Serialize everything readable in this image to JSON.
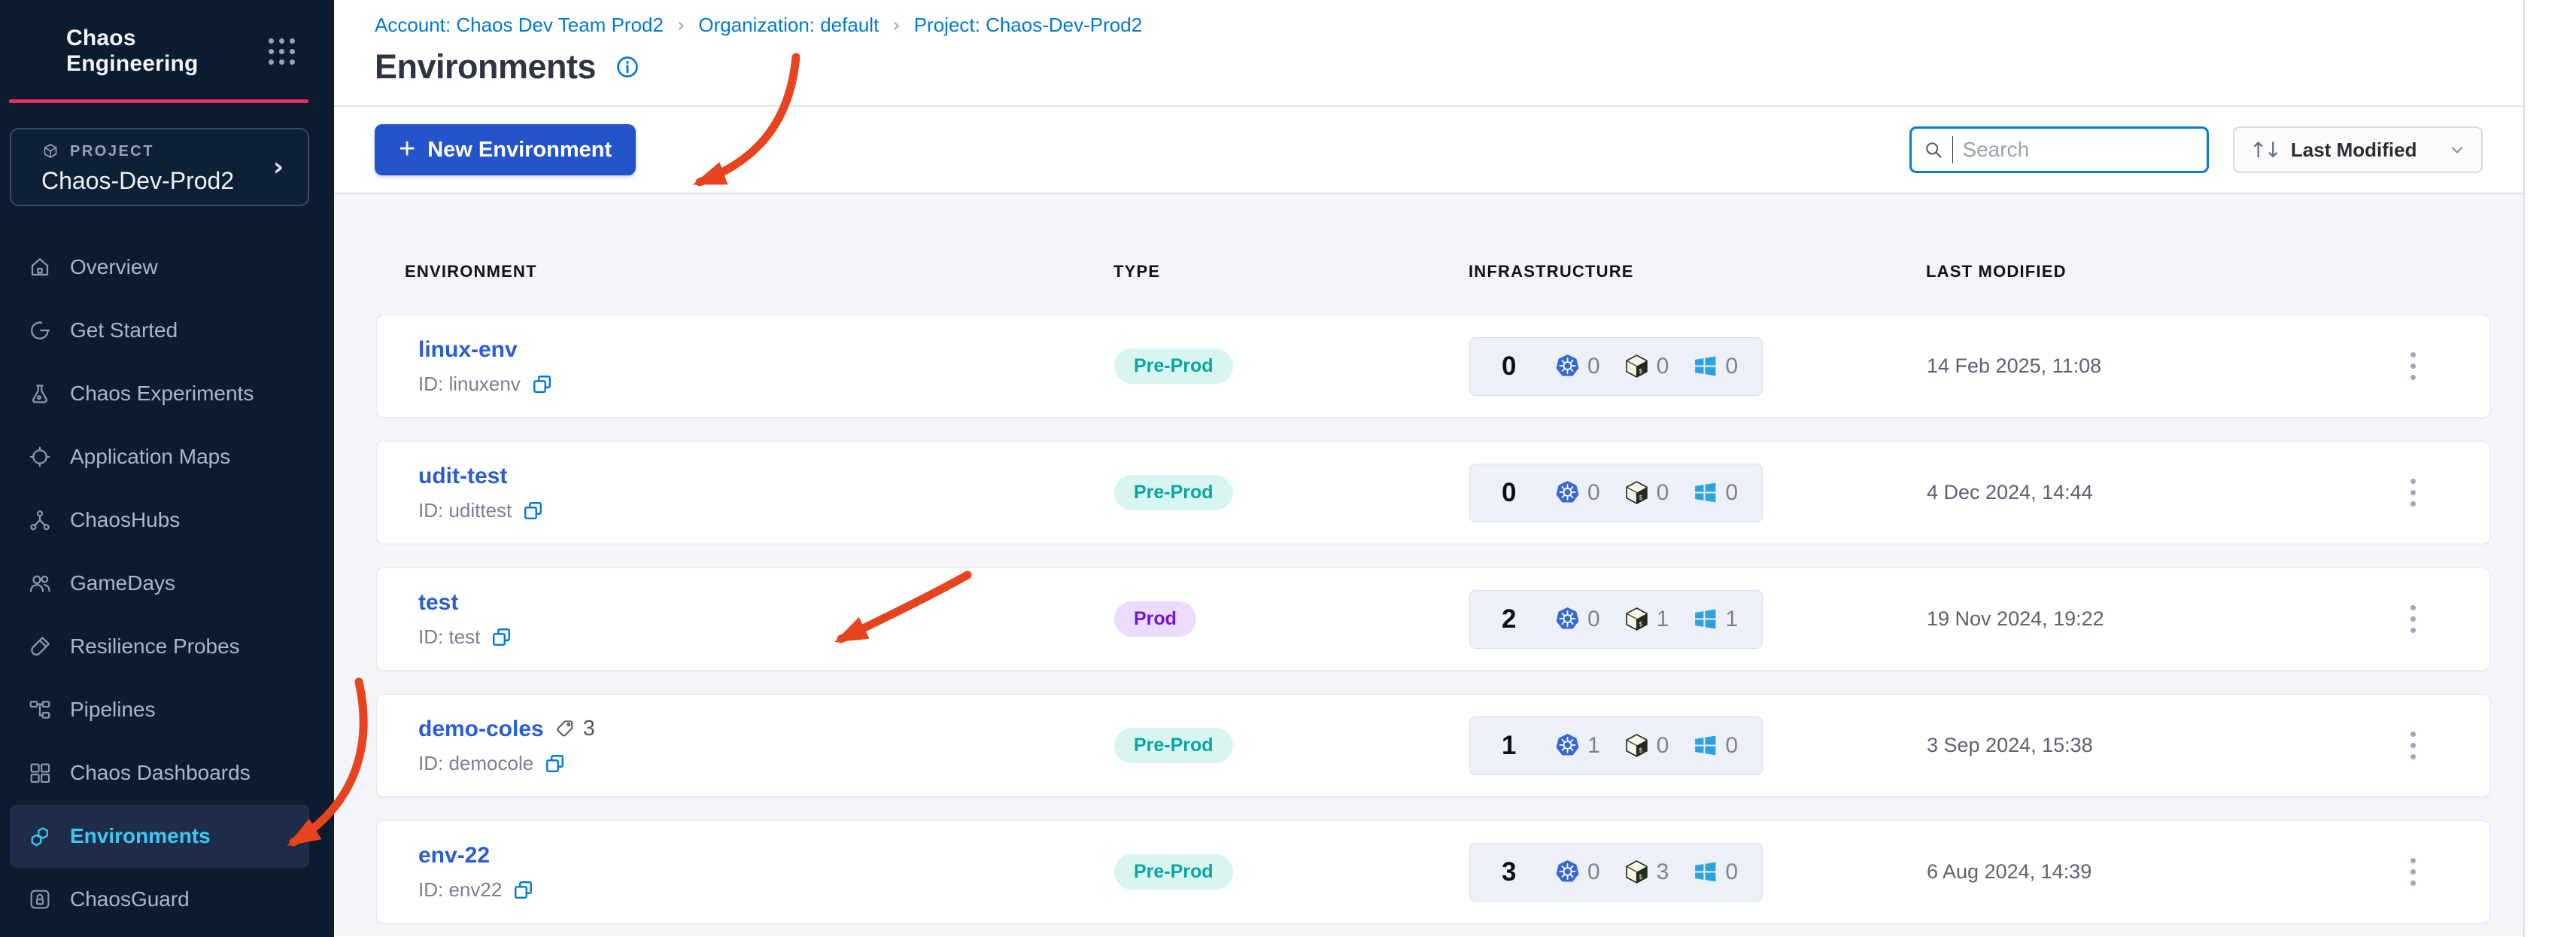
{
  "sidebar": {
    "brand": "Chaos Engineering",
    "project_label": "PROJECT",
    "project_name": "Chaos-Dev-Prod2",
    "project_chevron": "›",
    "items": [
      {
        "label": "Overview"
      },
      {
        "label": "Get Started"
      },
      {
        "label": "Chaos Experiments"
      },
      {
        "label": "Application Maps"
      },
      {
        "label": "ChaosHubs"
      },
      {
        "label": "GameDays"
      },
      {
        "label": "Resilience Probes"
      },
      {
        "label": "Pipelines"
      },
      {
        "label": "Chaos Dashboards"
      },
      {
        "label": "Environments"
      },
      {
        "label": "ChaosGuard"
      }
    ]
  },
  "breadcrumb": {
    "account": "Account: Chaos Dev Team Prod2",
    "org": "Organization: default",
    "project": "Project: Chaos-Dev-Prod2",
    "separator": "›"
  },
  "page": {
    "title": "Environments"
  },
  "toolbar": {
    "plus": "+",
    "new_button": "New Environment",
    "search_placeholder": "Search",
    "sort_arrows": "↑↓",
    "sort_label": "Last Modified"
  },
  "table": {
    "headers": [
      "ENVIRONMENT",
      "TYPE",
      "INFRASTRUCTURE",
      "LAST MODIFIED"
    ]
  },
  "rows": [
    {
      "name": "linux-env",
      "id": "ID: linuxenv",
      "type": "Pre-Prod",
      "type_variant": "preprod",
      "total": "0",
      "k8s": "0",
      "linux": "0",
      "windows": "0",
      "modified": "14 Feb 2025, 11:08"
    },
    {
      "name": "udit-test",
      "id": "ID: udittest",
      "type": "Pre-Prod",
      "type_variant": "preprod",
      "total": "0",
      "k8s": "0",
      "linux": "0",
      "windows": "0",
      "modified": "4 Dec 2024, 14:44"
    },
    {
      "name": "test",
      "id": "ID: test",
      "type": "Prod",
      "type_variant": "prod",
      "total": "2",
      "k8s": "0",
      "linux": "1",
      "windows": "1",
      "modified": "19 Nov 2024, 19:22"
    },
    {
      "name": "demo-coles",
      "id": "ID: democole",
      "tags": "3",
      "type": "Pre-Prod",
      "type_variant": "preprod",
      "total": "1",
      "k8s": "1",
      "linux": "0",
      "windows": "0",
      "modified": "3 Sep 2024, 15:38"
    },
    {
      "name": "env-22",
      "id": "ID: env22",
      "type": "Pre-Prod",
      "type_variant": "preprod",
      "total": "3",
      "k8s": "0",
      "linux": "3",
      "windows": "0",
      "modified": "6 Aug 2024, 14:39"
    }
  ],
  "colors": {
    "sidebar_bg": "#0b1b30",
    "accent_pink": "#ef2b61",
    "active_cyan": "#3cc8f4",
    "primary_button": "#2454c9",
    "link_blue": "#0278d5",
    "name_blue": "#2a5cd5",
    "preprod_text": "#05a7a0",
    "prod_text": "#7112dd",
    "annotation_red": "#e8431f"
  }
}
